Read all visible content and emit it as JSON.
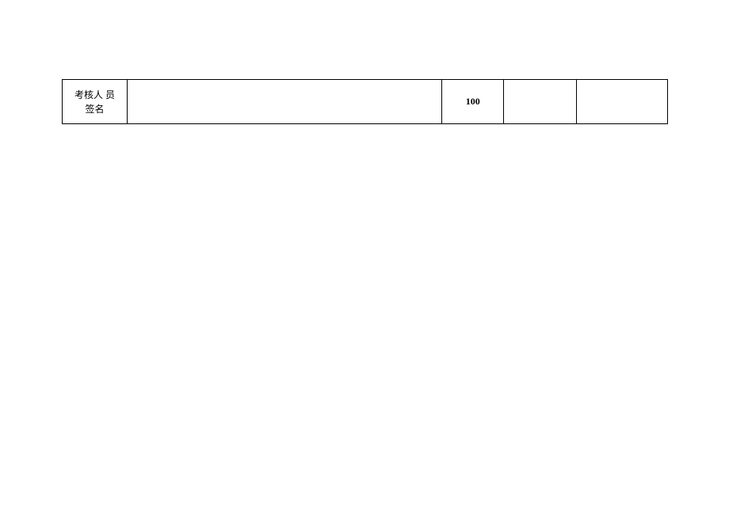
{
  "table": {
    "row1": {
      "label_line1": "考核人 员",
      "label_line2": "签名",
      "signature": "",
      "score": "100",
      "col4": "",
      "col5": ""
    }
  }
}
